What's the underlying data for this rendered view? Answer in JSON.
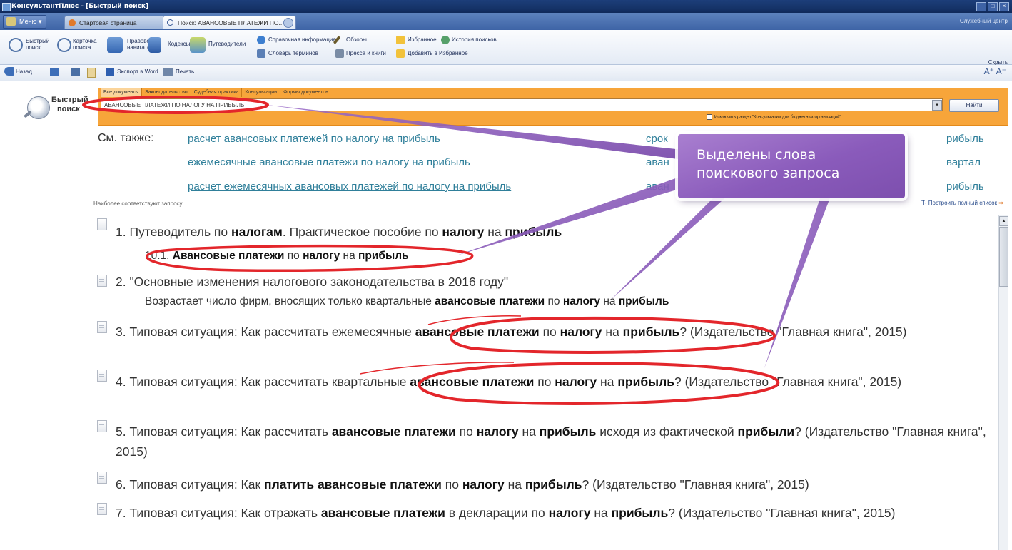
{
  "titlebar": {
    "title": "КонсультантПлюс - [Быстрый поиск]"
  },
  "tabs": {
    "menu": "Меню",
    "items": [
      {
        "label": "Стартовая страница"
      },
      {
        "label": "Поиск: АВАНСОВЫЕ ПЛАТЕЖИ ПО..."
      }
    ],
    "close": "×",
    "user": "Служебный центр"
  },
  "toolbar": {
    "buttons": [
      {
        "label": "Быстрый поиск"
      },
      {
        "label": "Карточка поиска"
      },
      {
        "label": "Правовой навигатор"
      },
      {
        "label": "Кодексы"
      },
      {
        "label": "Путеводители"
      }
    ],
    "small": {
      "reference": "Справочная информация",
      "reviews": "Обзоры",
      "favorites": "Избранное",
      "history": "История поисков",
      "dictionary": "Словарь терминов",
      "press": "Пресса и книги",
      "add_fav": "Добавить в Избранное"
    },
    "hide": "Скрыть"
  },
  "navbar": {
    "back": "Назад",
    "export": "Экспорт в Word",
    "print": "Печать",
    "font_size": "A⁺ A⁻"
  },
  "search": {
    "title_line1": "Быстрый",
    "title_line2": "поиск",
    "filters": [
      "Все документы",
      "Законодательство",
      "Судебная практика",
      "Консультации",
      "Формы документов"
    ],
    "query": "АВАНСОВЫЕ ПЛАТЕЖИ ПО НАЛОГУ НА ПРИБЫЛЬ",
    "find": "Найти",
    "exclude": "Исключить раздел \"Консультации для бюджетных организаций\""
  },
  "see_also": {
    "label": "См. также:",
    "links": [
      "расчет авансовых платежей по налогу на прибыль",
      "ежемесячные авансовые платежи по налогу на прибыль",
      "расчет ежемесячных авансовых платежей по налогу на прибыль",
      "срок",
      "аван",
      "аван",
      "рибыль",
      "вартал",
      "рибыль"
    ]
  },
  "results_header": {
    "match": "Наиболее соответствуют запросу:",
    "build": "Построить полный список"
  },
  "callout": {
    "line1": "Выделены слова",
    "line2": "поискового запроса"
  }
}
